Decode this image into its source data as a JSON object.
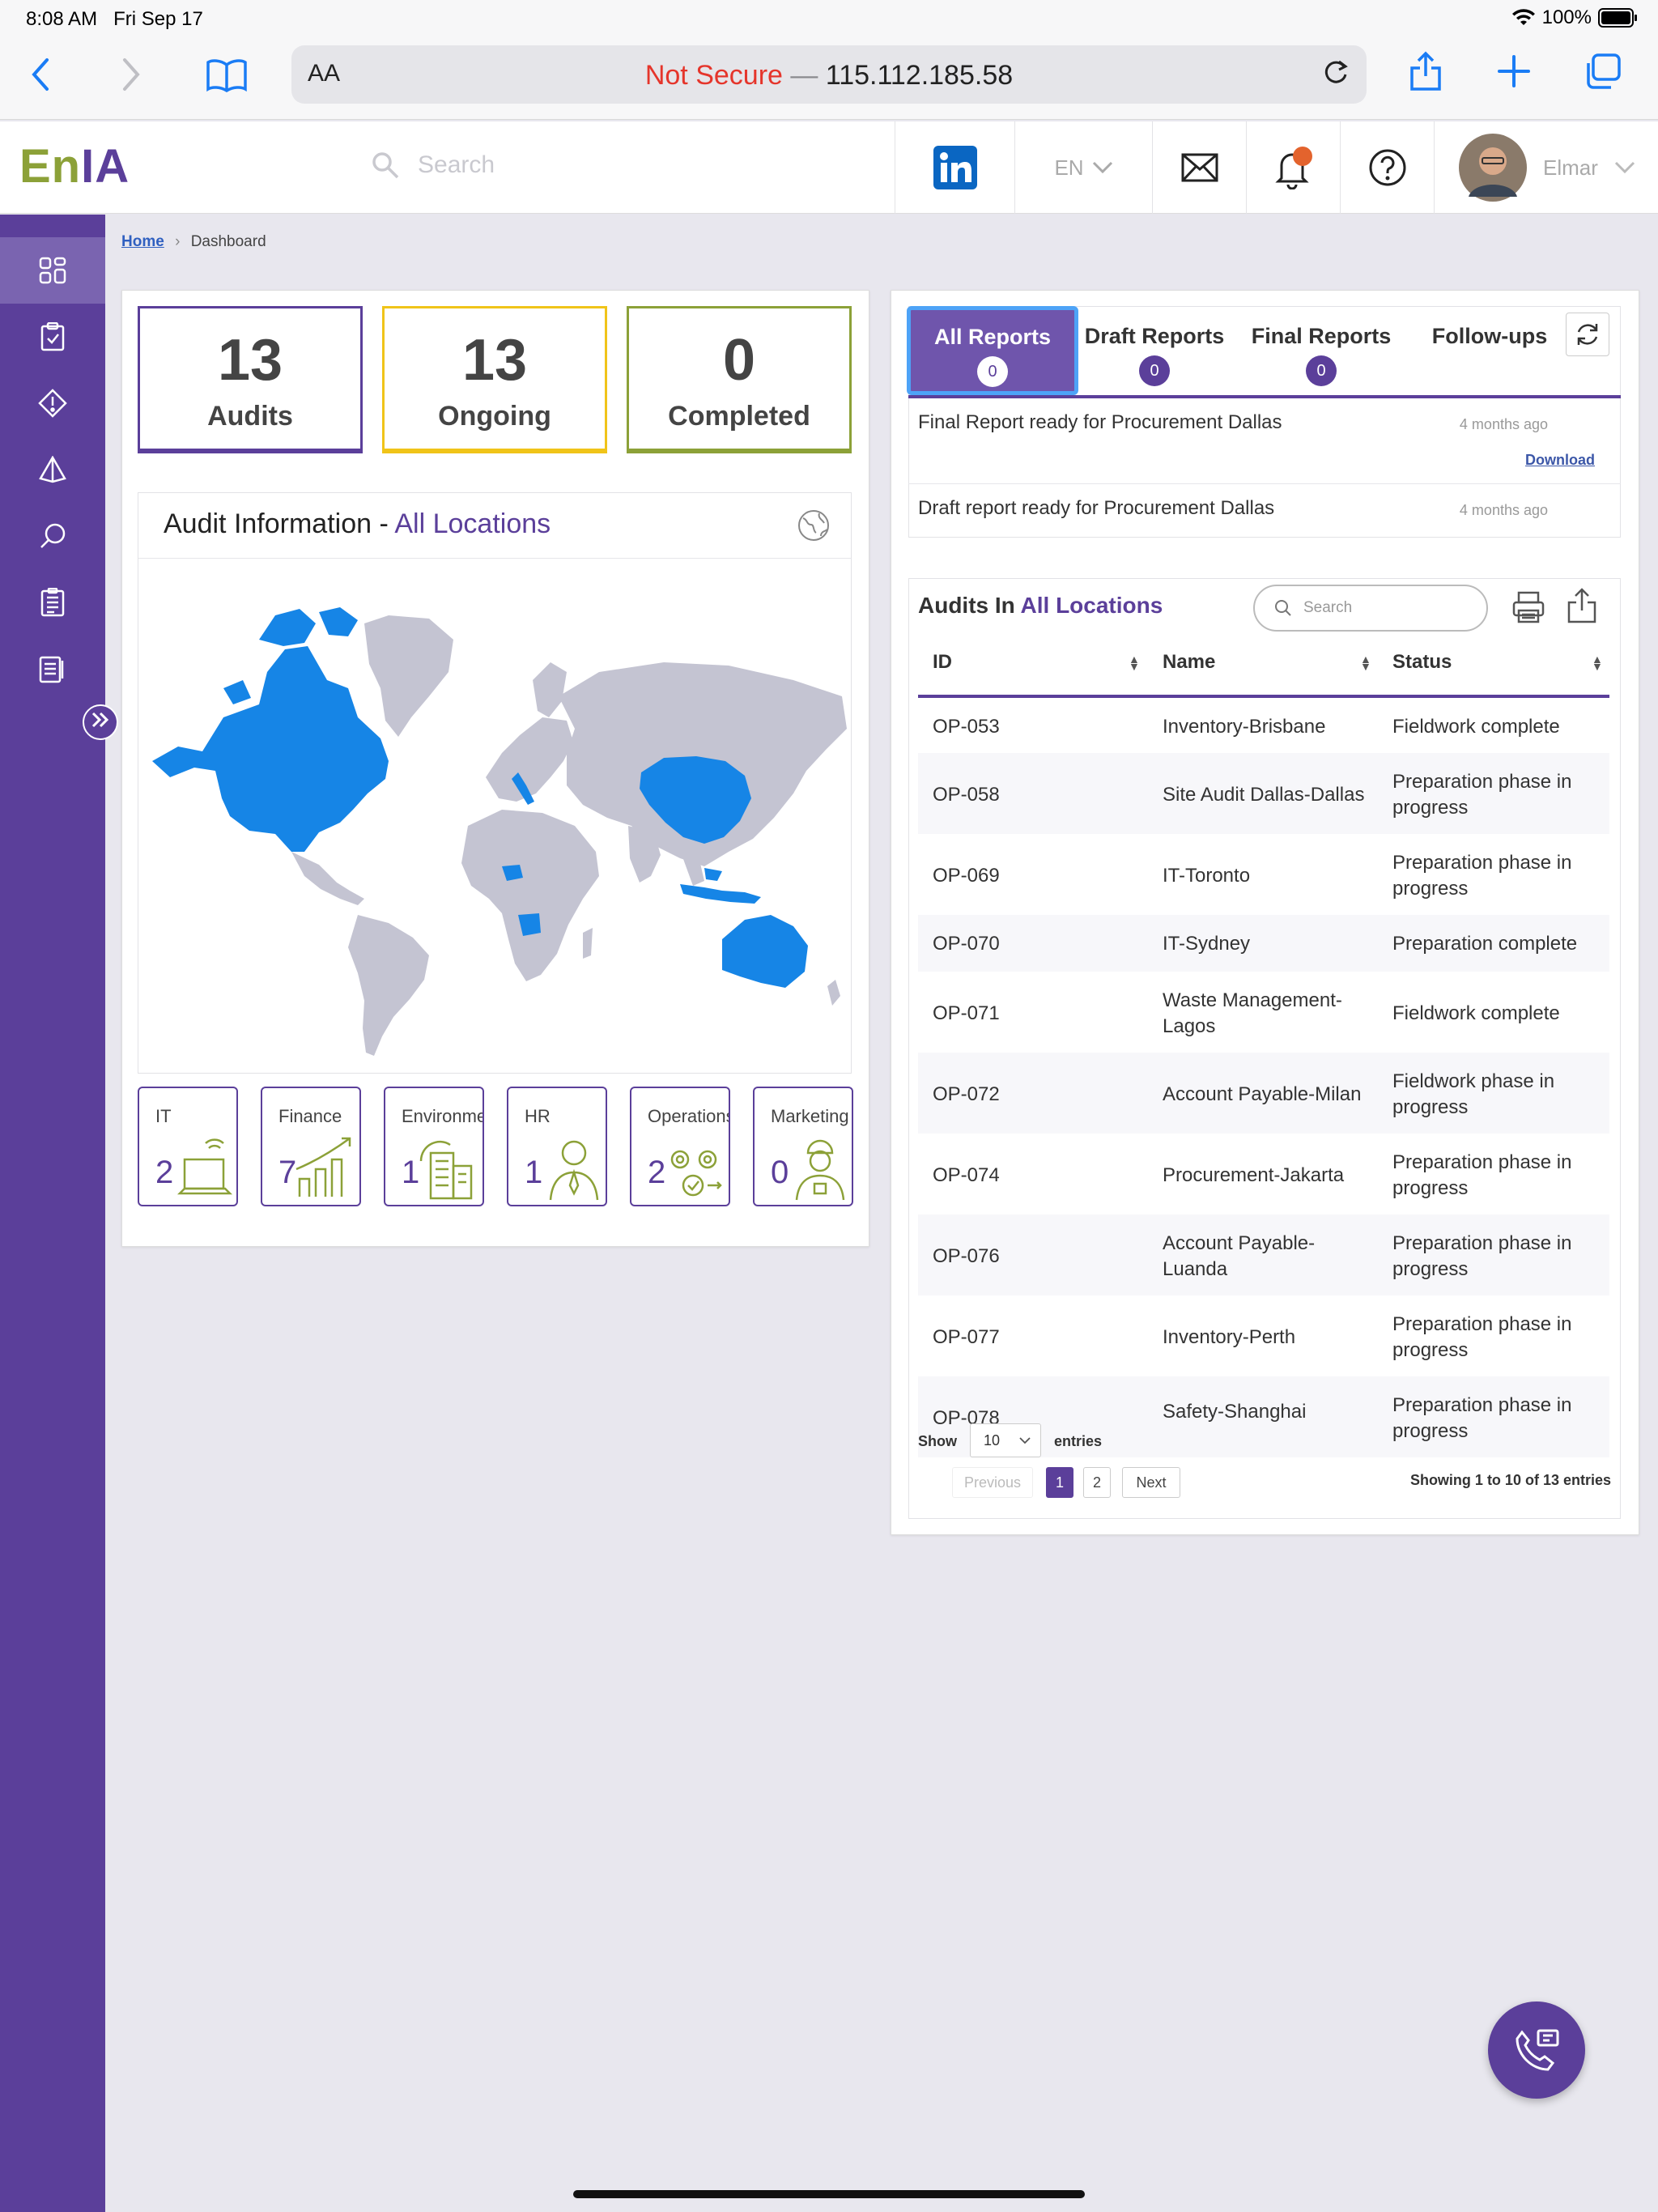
{
  "status_bar": {
    "time": "8:08 AM",
    "date": "Fri Sep 17",
    "battery": "100%"
  },
  "browser": {
    "text_size_label": "AA",
    "security": "Not Secure",
    "separator": "—",
    "address": "115.112.185.58"
  },
  "header": {
    "logo_part1": "En",
    "logo_part2": "IA",
    "search_placeholder": "Search",
    "language": "EN",
    "user_name": "Elmar"
  },
  "breadcrumb": {
    "home": "Home",
    "current": "Dashboard"
  },
  "kpis": [
    {
      "value": "13",
      "label": "Audits",
      "color": "#5b3f9a"
    },
    {
      "value": "13",
      "label": "Ongoing",
      "color": "#f0c419"
    },
    {
      "value": "0",
      "label": "Completed",
      "color": "#8ca138"
    }
  ],
  "audit_info": {
    "title": "Audit Information - ",
    "location": "All Locations"
  },
  "departments": [
    {
      "name": "IT",
      "count": "2",
      "icon": "laptop-icon"
    },
    {
      "name": "Finance",
      "count": "7",
      "icon": "growth-chart-icon"
    },
    {
      "name": "Environment",
      "count": "1",
      "icon": "buildings-icon"
    },
    {
      "name": "HR",
      "count": "1",
      "icon": "person-icon"
    },
    {
      "name": "Operations",
      "count": "2",
      "icon": "gears-icon"
    },
    {
      "name": "Marketing",
      "count": "0",
      "icon": "worker-icon"
    }
  ],
  "report_tabs": [
    {
      "label": "All Reports",
      "count": "0",
      "active": true
    },
    {
      "label": "Draft Reports",
      "count": "0"
    },
    {
      "label": "Final Reports",
      "count": "0"
    },
    {
      "label": "Follow-ups"
    }
  ],
  "reports": [
    {
      "title": "Final Report ready for Procurement Dallas",
      "time": "4 months ago",
      "action": "Download"
    },
    {
      "title": "Draft report ready for Procurement Dallas",
      "time": "4 months ago"
    }
  ],
  "audits_table": {
    "title": "Audits In ",
    "location": "All Locations",
    "search_placeholder": "Search",
    "columns": [
      "ID",
      "Name",
      "Status"
    ],
    "rows": [
      {
        "id": "OP-053",
        "name": "Inventory-Brisbane",
        "status": "Fieldwork complete"
      },
      {
        "id": "OP-058",
        "name": "Site Audit Dallas-Dallas",
        "status": "Preparation phase in progress"
      },
      {
        "id": "OP-069",
        "name": "IT-Toronto",
        "status": "Preparation phase in progress"
      },
      {
        "id": "OP-070",
        "name": "IT-Sydney",
        "status": "Preparation complete"
      },
      {
        "id": "OP-071",
        "name": "Waste Management-Lagos",
        "status": "Fieldwork complete"
      },
      {
        "id": "OP-072",
        "name": "Account Payable-Milan",
        "status": "Fieldwork phase in progress"
      },
      {
        "id": "OP-074",
        "name": "Procurement-Jakarta",
        "status": "Preparation phase in progress"
      },
      {
        "id": "OP-076",
        "name": "Account Payable-Luanda",
        "status": "Preparation phase in progress"
      },
      {
        "id": "OP-077",
        "name": "Inventory-Perth",
        "status": "Preparation phase in progress"
      },
      {
        "id": "OP-078",
        "name": "Safety-Shanghai",
        "status": "Preparation phase in progress"
      }
    ],
    "show_label": "Show",
    "page_size": "10",
    "entries_label": "entries",
    "previous": "Previous",
    "pages": [
      "1",
      "2"
    ],
    "next": "Next",
    "summary": "Showing 1 to 10 of 13 entries"
  },
  "colors": {
    "brand_purple": "#5b3f9a",
    "brand_green": "#8ca138",
    "map_highlight": "#1685e6",
    "map_land": "#c4c4d2"
  }
}
